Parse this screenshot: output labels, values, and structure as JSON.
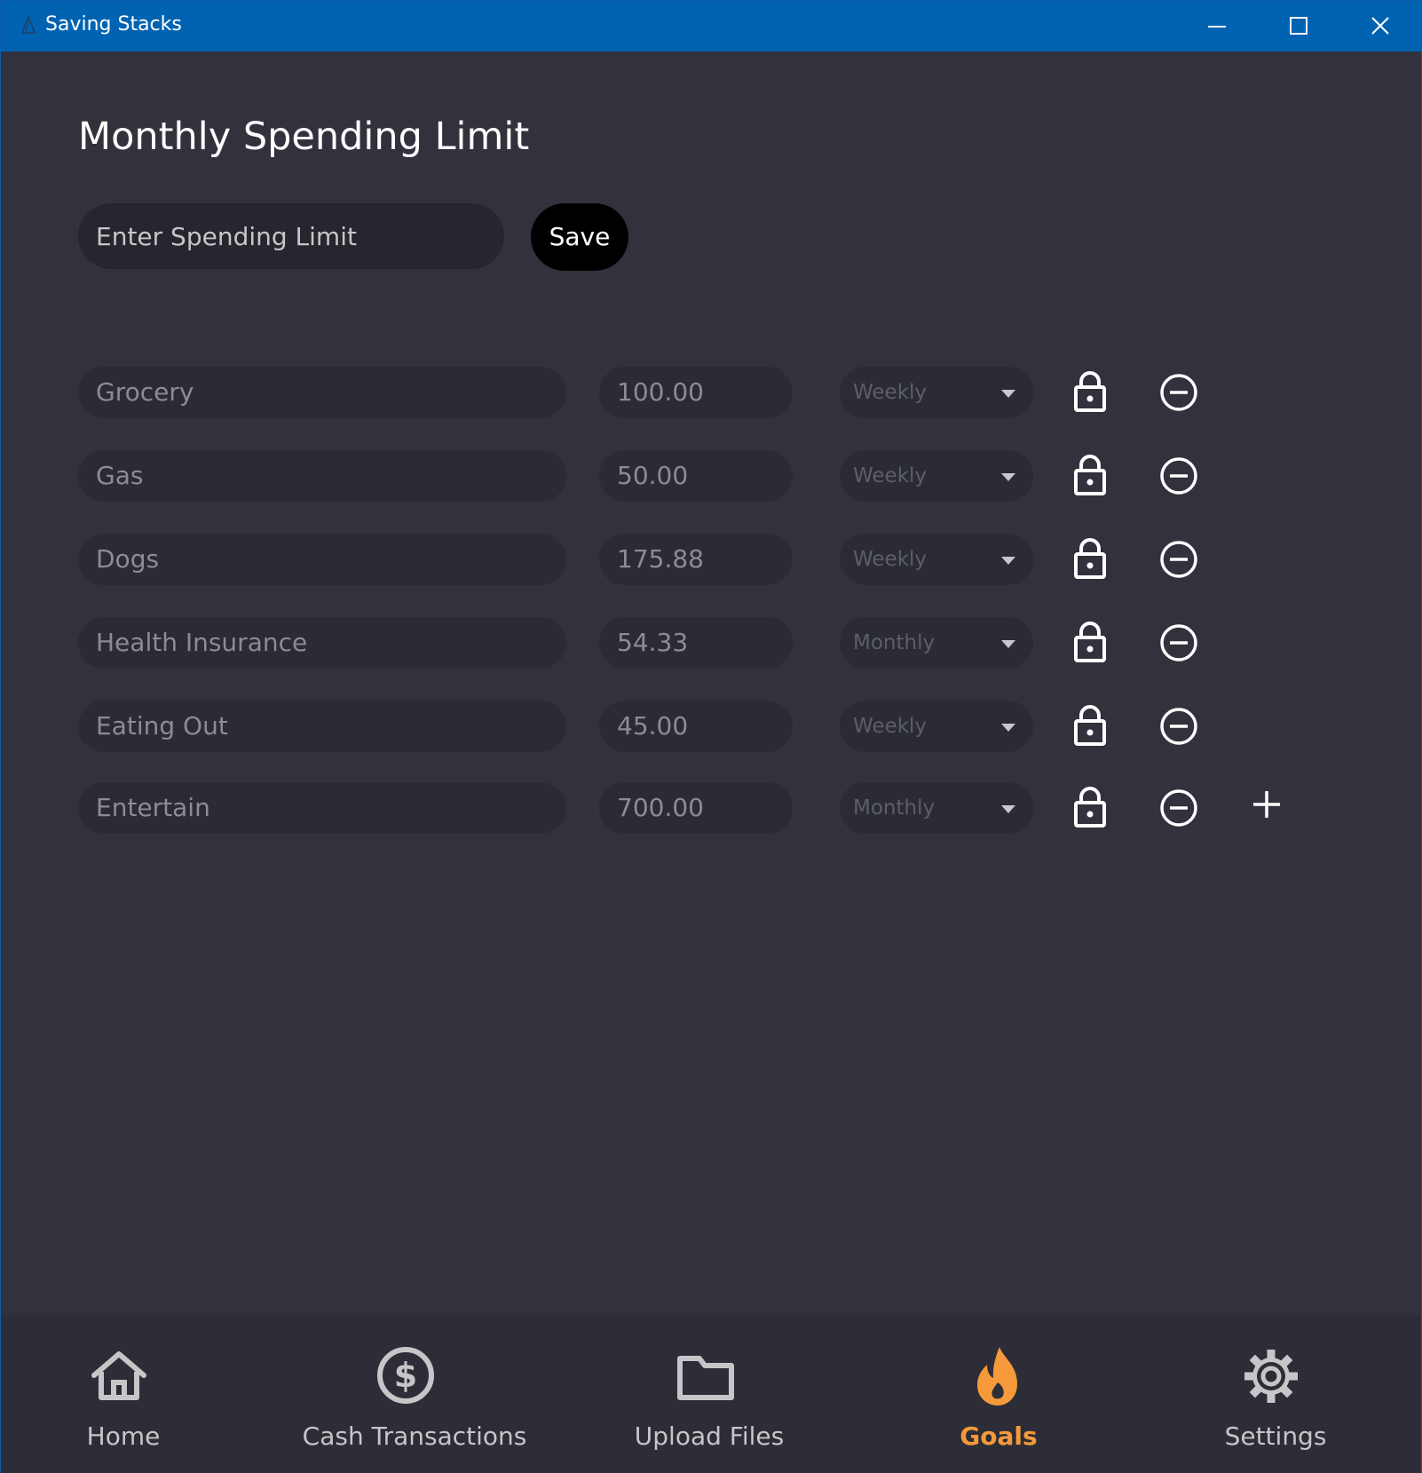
{
  "window": {
    "title": "Saving Stacks"
  },
  "page": {
    "title": "Monthly Spending Limit",
    "limit_input": {
      "value": "",
      "placeholder": "Enter Spending Limit"
    },
    "save_label": "Save"
  },
  "categories": [
    {
      "name": "Grocery",
      "amount": "100.00",
      "frequency": "Weekly"
    },
    {
      "name": "Gas",
      "amount": "50.00",
      "frequency": "Weekly"
    },
    {
      "name": "Dogs",
      "amount": "175.88",
      "frequency": "Weekly"
    },
    {
      "name": "Health Insurance",
      "amount": "54.33",
      "frequency": "Monthly"
    },
    {
      "name": "Eating Out",
      "amount": "45.00",
      "frequency": "Weekly"
    },
    {
      "name": "Entertain",
      "amount": "700.00",
      "frequency": "Monthly"
    }
  ],
  "nav": {
    "items": [
      {
        "label": "Home",
        "icon": "home-icon"
      },
      {
        "label": "Cash Transactions",
        "icon": "dollar-circle-icon"
      },
      {
        "label": "Upload Files",
        "icon": "folder-icon"
      },
      {
        "label": "Goals",
        "icon": "flame-icon",
        "active": true
      },
      {
        "label": "Settings",
        "icon": "gear-icon"
      }
    ],
    "active_color": "#f6993a"
  },
  "colors": {
    "titlebar": "#0063b1",
    "background": "#31323c",
    "accent": "#f6993a"
  }
}
